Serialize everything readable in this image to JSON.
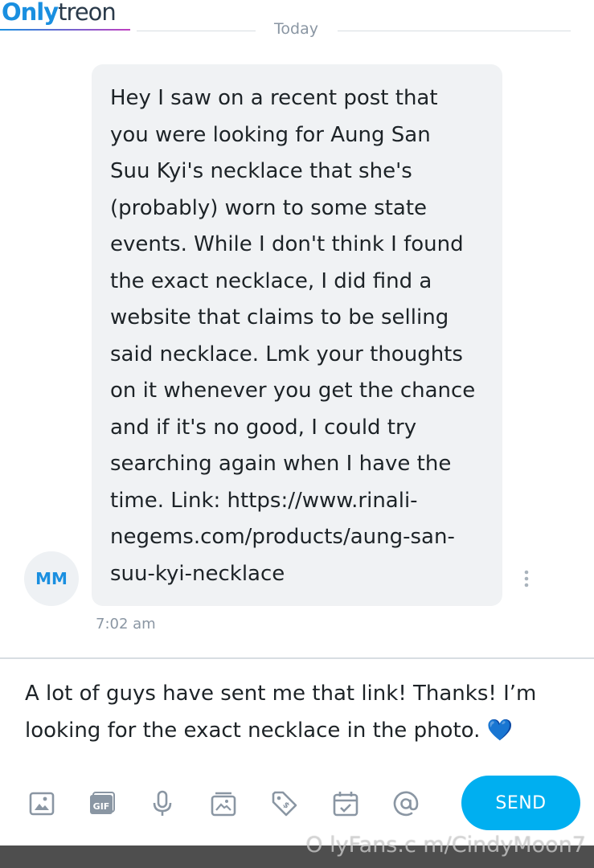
{
  "watermark": {
    "brand_part1": "Only",
    "brand_part2": "treon",
    "bottom_text": "O lyFans.c m/CindyMoon7"
  },
  "date_divider": "Today",
  "message": {
    "sender_initials": "MM",
    "text": "Hey I saw on a recent post that\nyou were looking for Aung San\nSuu Kyi's necklace that she's\n(probably) worn to some state\nevents. While I don't think I found\nthe exact necklace, I did find a\nwebsite that claims to be selling\nsaid necklace. Lmk your thoughts\non it whenever you get the chance\nand if it's no good, I could try\nsearching again when I have the\ntime. Link: https://www.rinali-\nnegems.com/products/aung-san-\nsuu-kyi-necklace",
    "time": "7:02 am"
  },
  "composer": {
    "text": "A lot of guys have sent me that link! Thanks! I’m looking for the exact necklace in the photo.",
    "emoji": "💙"
  },
  "toolbar": {
    "icons": [
      "image-icon",
      "gif-icon",
      "microphone-icon",
      "vault-icon",
      "price-tag-icon",
      "schedule-icon",
      "mention-icon"
    ],
    "send_label": "SEND"
  },
  "colors": {
    "accent": "#00aff0",
    "icon_gray": "#8a96a3",
    "bubble_bg": "#f0f2f4"
  }
}
